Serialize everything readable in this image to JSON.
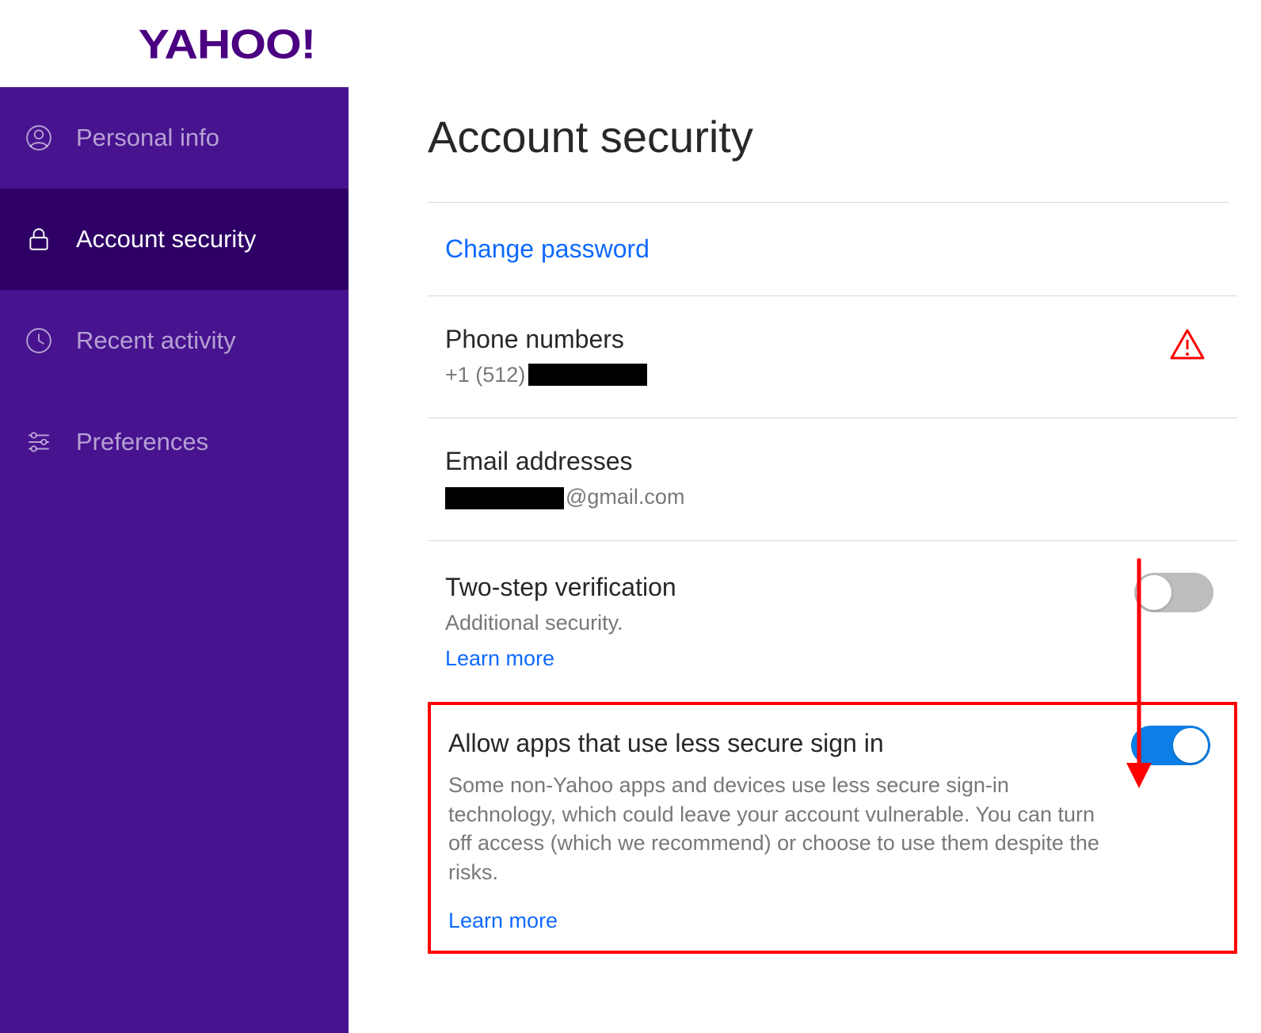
{
  "brand": "YAHOO!",
  "sidebar": {
    "items": [
      {
        "label": "Personal info"
      },
      {
        "label": "Account security"
      },
      {
        "label": "Recent activity"
      },
      {
        "label": "Preferences"
      }
    ]
  },
  "page": {
    "title": "Account security",
    "change_password": "Change password",
    "phone": {
      "title": "Phone numbers",
      "prefix": "+1 (512)"
    },
    "email": {
      "title": "Email addresses",
      "domain": "@gmail.com"
    },
    "two_step": {
      "title": "Two-step verification",
      "sub": "Additional security.",
      "learn_more": "Learn more",
      "enabled": false
    },
    "less_secure": {
      "title": "Allow apps that use less secure sign in",
      "desc": "Some non-Yahoo apps and devices use less secure sign-in technology, which could leave your account vulnerable. You can turn off access (which we recommend) or choose to use them despite the risks.",
      "learn_more": "Learn more",
      "enabled": true
    }
  },
  "colors": {
    "brand_purple": "#47138f",
    "brand_purple_dark": "#2e0066",
    "link_blue": "#0f69ff",
    "toggle_on": "#0b7fe6",
    "toggle_off": "#bdbdbd",
    "alert_red": "#ff0000"
  }
}
